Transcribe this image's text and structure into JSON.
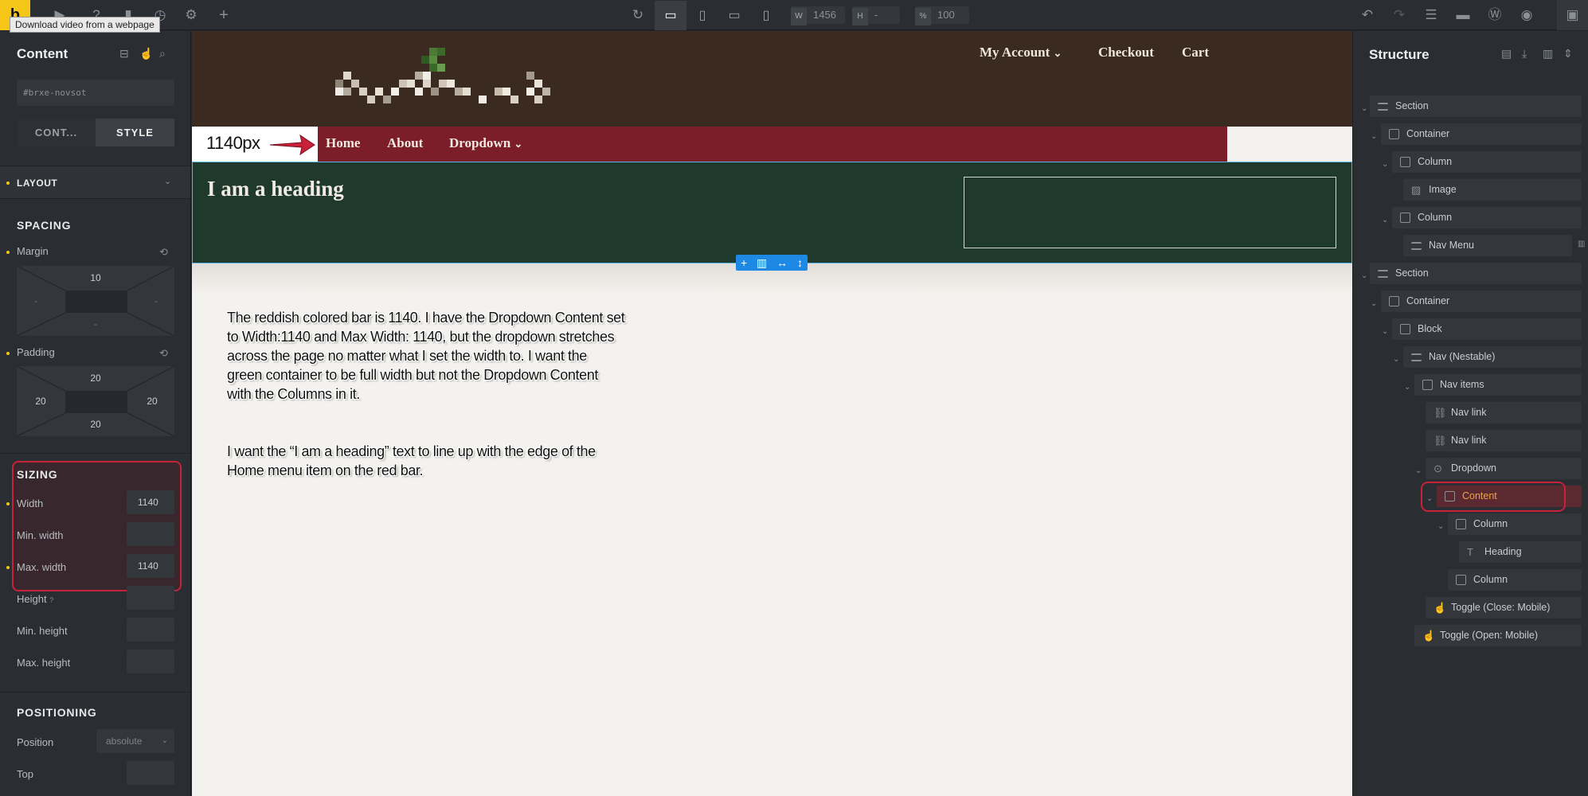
{
  "toolbar": {
    "logo_letter": "b",
    "tooltip": "Download video from a webpage",
    "width_label": "W",
    "width_value": "1456",
    "height_label": "H",
    "height_value": "-",
    "zoom_label": "%",
    "zoom_value": "100"
  },
  "left_panel": {
    "title": "Content",
    "element_id": "#brxe-novsot",
    "tabs": [
      "CONT...",
      "STYLE"
    ],
    "layout_group": "LAYOUT",
    "spacing_title": "SPACING",
    "margin_label": "Margin",
    "margin": {
      "top": "10",
      "right": "-",
      "bottom": "-",
      "left": "-"
    },
    "padding_label": "Padding",
    "padding": {
      "top": "20",
      "right": "20",
      "bottom": "20",
      "left": "20"
    },
    "sizing_title": "SIZING",
    "width_label": "Width",
    "width_value": "1140",
    "min_width_label": "Min. width",
    "max_width_label": "Max. width",
    "max_width_value": "1140",
    "height_label": "Height",
    "min_height_label": "Min. height",
    "max_height_label": "Max. height",
    "positioning_title": "POSITIONING",
    "position_label": "Position",
    "position_value": "absolute",
    "top_label": "Top"
  },
  "canvas": {
    "account_nav": [
      "My Account",
      "Checkout",
      "Cart"
    ],
    "px_annotation": "1140px",
    "nav_items": [
      "Home",
      "About",
      "Dropdown"
    ],
    "heading": "I am a heading",
    "note_1": "The reddish colored bar is 1140. I have the Dropdown Content set to Width:1140 and Max Width: 1140, but the dropdown stretches across the page no matter what I set the width to. I want the green container to be full width but not the Dropdown Content with the Columns in it.",
    "note_2": "I want the “I am a heading” text to line up with the edge of the Home menu item on the red bar.",
    "colors": {
      "header": "#3a2a20",
      "nav_bar": "#7b1e2a",
      "green_container": "#1f3a2c",
      "highlight": "#c8223a"
    }
  },
  "structure": {
    "title": "Structure",
    "items": [
      {
        "label": "Section",
        "icon": "section-icon"
      },
      {
        "label": "Container",
        "icon": "container-icon"
      },
      {
        "label": "Column",
        "icon": "container-icon"
      },
      {
        "label": "Image",
        "icon": "image-icon"
      },
      {
        "label": "Column",
        "icon": "container-icon"
      },
      {
        "label": "Nav Menu",
        "icon": "menu-icon"
      },
      {
        "label": "Section",
        "icon": "section-icon"
      },
      {
        "label": "Container",
        "icon": "container-icon"
      },
      {
        "label": "Block",
        "icon": "container-icon"
      },
      {
        "label": "Nav (Nestable)",
        "icon": "menu-icon"
      },
      {
        "label": "Nav items",
        "icon": "container-icon"
      },
      {
        "label": "Nav link",
        "icon": "link-icon"
      },
      {
        "label": "Nav link",
        "icon": "link-icon"
      },
      {
        "label": "Dropdown",
        "icon": "dropdown-icon"
      },
      {
        "label": "Content",
        "icon": "container-icon",
        "selected": true
      },
      {
        "label": "Column",
        "icon": "container-icon"
      },
      {
        "label": "Heading",
        "icon": "heading-icon"
      },
      {
        "label": "Column",
        "icon": "container-icon"
      },
      {
        "label": "Toggle (Close: Mobile)",
        "icon": "hand-icon"
      },
      {
        "label": "Toggle (Open: Mobile)",
        "icon": "hand-icon"
      }
    ]
  }
}
